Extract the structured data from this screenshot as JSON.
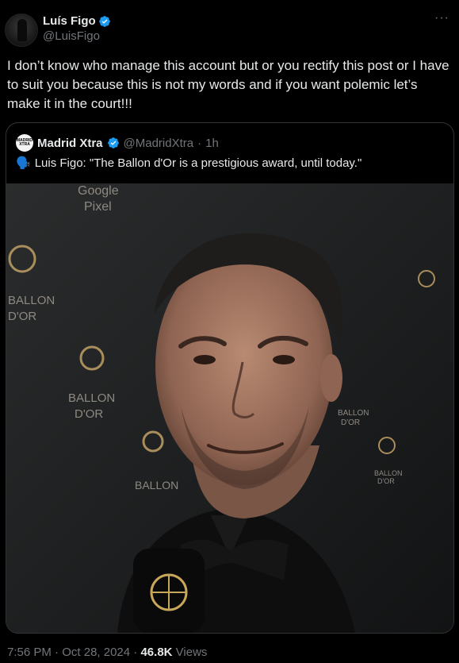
{
  "author": {
    "name": "Luís Figo",
    "handle": "@LuisFigo"
  },
  "more_label": "···",
  "tweet": {
    "text": "I don’t know who manage this account but or you rectify this post or I have to suit you because this is not my words and if you want polemic let’s make it in the court!!!"
  },
  "quote": {
    "avatar_text": "MADRID XTRA",
    "name": "Madrid Xtra",
    "handle": "@MadridXtra",
    "separator": "·",
    "time": "1h",
    "speaker_emoji": "🗣️",
    "text": "Luis Figo: \"The Ballon d'Or is a prestigious award, until today.\"",
    "image": {
      "backdrop_texts": [
        "Google",
        "Pixel",
        "BALLON",
        "D'OR",
        "BALLON",
        "D'OR",
        "BALLON",
        "BALLON",
        "D'OR",
        "BALLON",
        "D'OR"
      ]
    }
  },
  "footer": {
    "time": "7:56 PM",
    "dot1": "·",
    "date": "Oct 28, 2024",
    "dot2": "·",
    "views_count": "46.8K",
    "views_label": "Views"
  },
  "colors": {
    "background": "#000000",
    "text": "#e7e9ea",
    "muted": "#71767b",
    "verified": "#1d9bf0",
    "border": "#2f3336"
  }
}
